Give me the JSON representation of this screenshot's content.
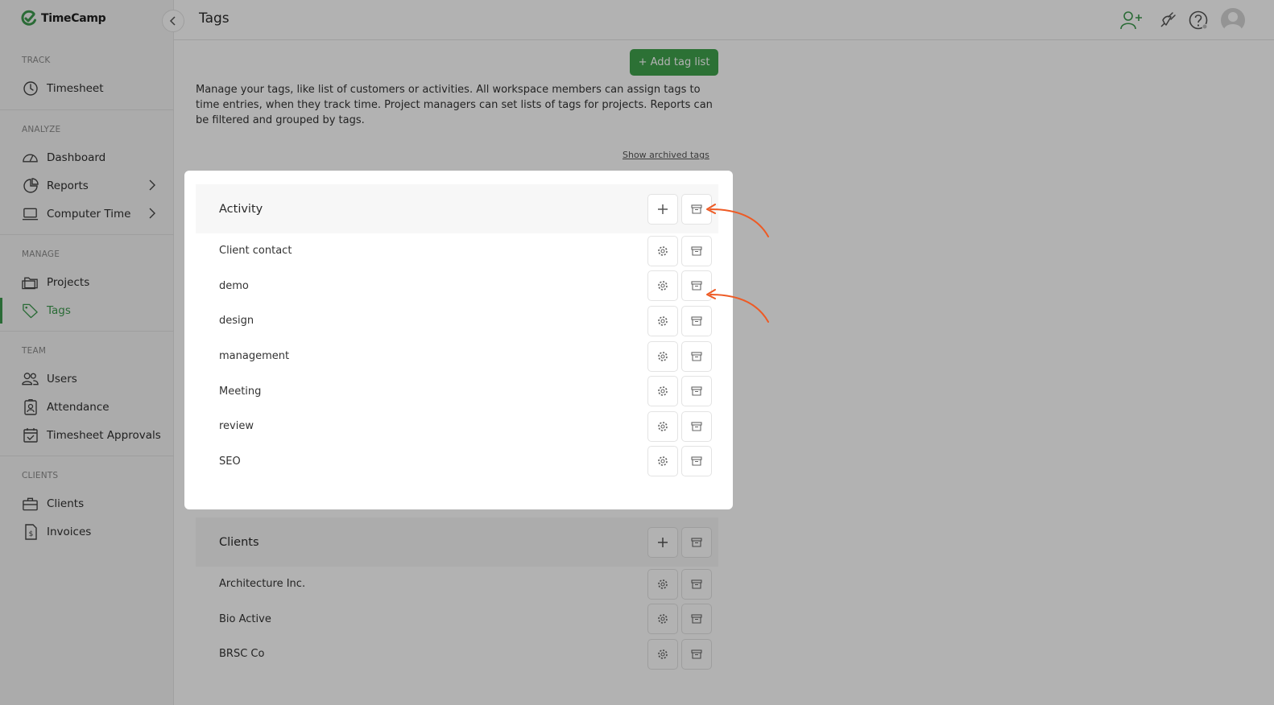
{
  "app": {
    "name": "TimeCamp",
    "brand_color": "#3d9a4e",
    "accent_arrow_color": "#ee5a24"
  },
  "header": {
    "title": "Tags",
    "icons": [
      "add-user-icon",
      "plug-icon",
      "help-icon",
      "avatar"
    ]
  },
  "sidebar": {
    "sections": [
      {
        "label": "TRACK",
        "items": [
          {
            "label": "Timesheet",
            "icon": "clock-icon"
          }
        ]
      },
      {
        "label": "ANALYZE",
        "items": [
          {
            "label": "Dashboard",
            "icon": "gauge-icon"
          },
          {
            "label": "Reports",
            "icon": "pie-chart-icon",
            "has_submenu": true
          },
          {
            "label": "Computer Time",
            "icon": "laptop-icon",
            "has_submenu": true
          }
        ]
      },
      {
        "label": "MANAGE",
        "items": [
          {
            "label": "Projects",
            "icon": "folder-icon"
          },
          {
            "label": "Tags",
            "icon": "tag-icon",
            "active": true
          }
        ]
      },
      {
        "label": "TEAM",
        "items": [
          {
            "label": "Users",
            "icon": "users-icon"
          },
          {
            "label": "Attendance",
            "icon": "badge-icon"
          },
          {
            "label": "Timesheet Approvals",
            "icon": "calendar-check-icon"
          }
        ]
      },
      {
        "label": "CLIENTS",
        "items": [
          {
            "label": "Clients",
            "icon": "briefcase-icon"
          },
          {
            "label": "Invoices",
            "icon": "invoice-icon"
          }
        ]
      }
    ]
  },
  "main": {
    "add_tag_list_label": "+ Add tag list",
    "intro": "Manage your tags, like list of customers or activities. All workspace members can assign tags to time entries, when they track time. Project managers can set lists of tags for projects. Reports can be filtered and grouped by tags.",
    "show_archived_label": "Show archived tags",
    "tag_lists": [
      {
        "name": "Activity",
        "tags": [
          "Client contact",
          "demo",
          "design",
          "management",
          "Meeting",
          "review",
          "SEO"
        ]
      },
      {
        "name": "Clients",
        "tags": [
          "Architecture Inc.",
          "Bio Active",
          "BRSC Co"
        ]
      }
    ]
  }
}
